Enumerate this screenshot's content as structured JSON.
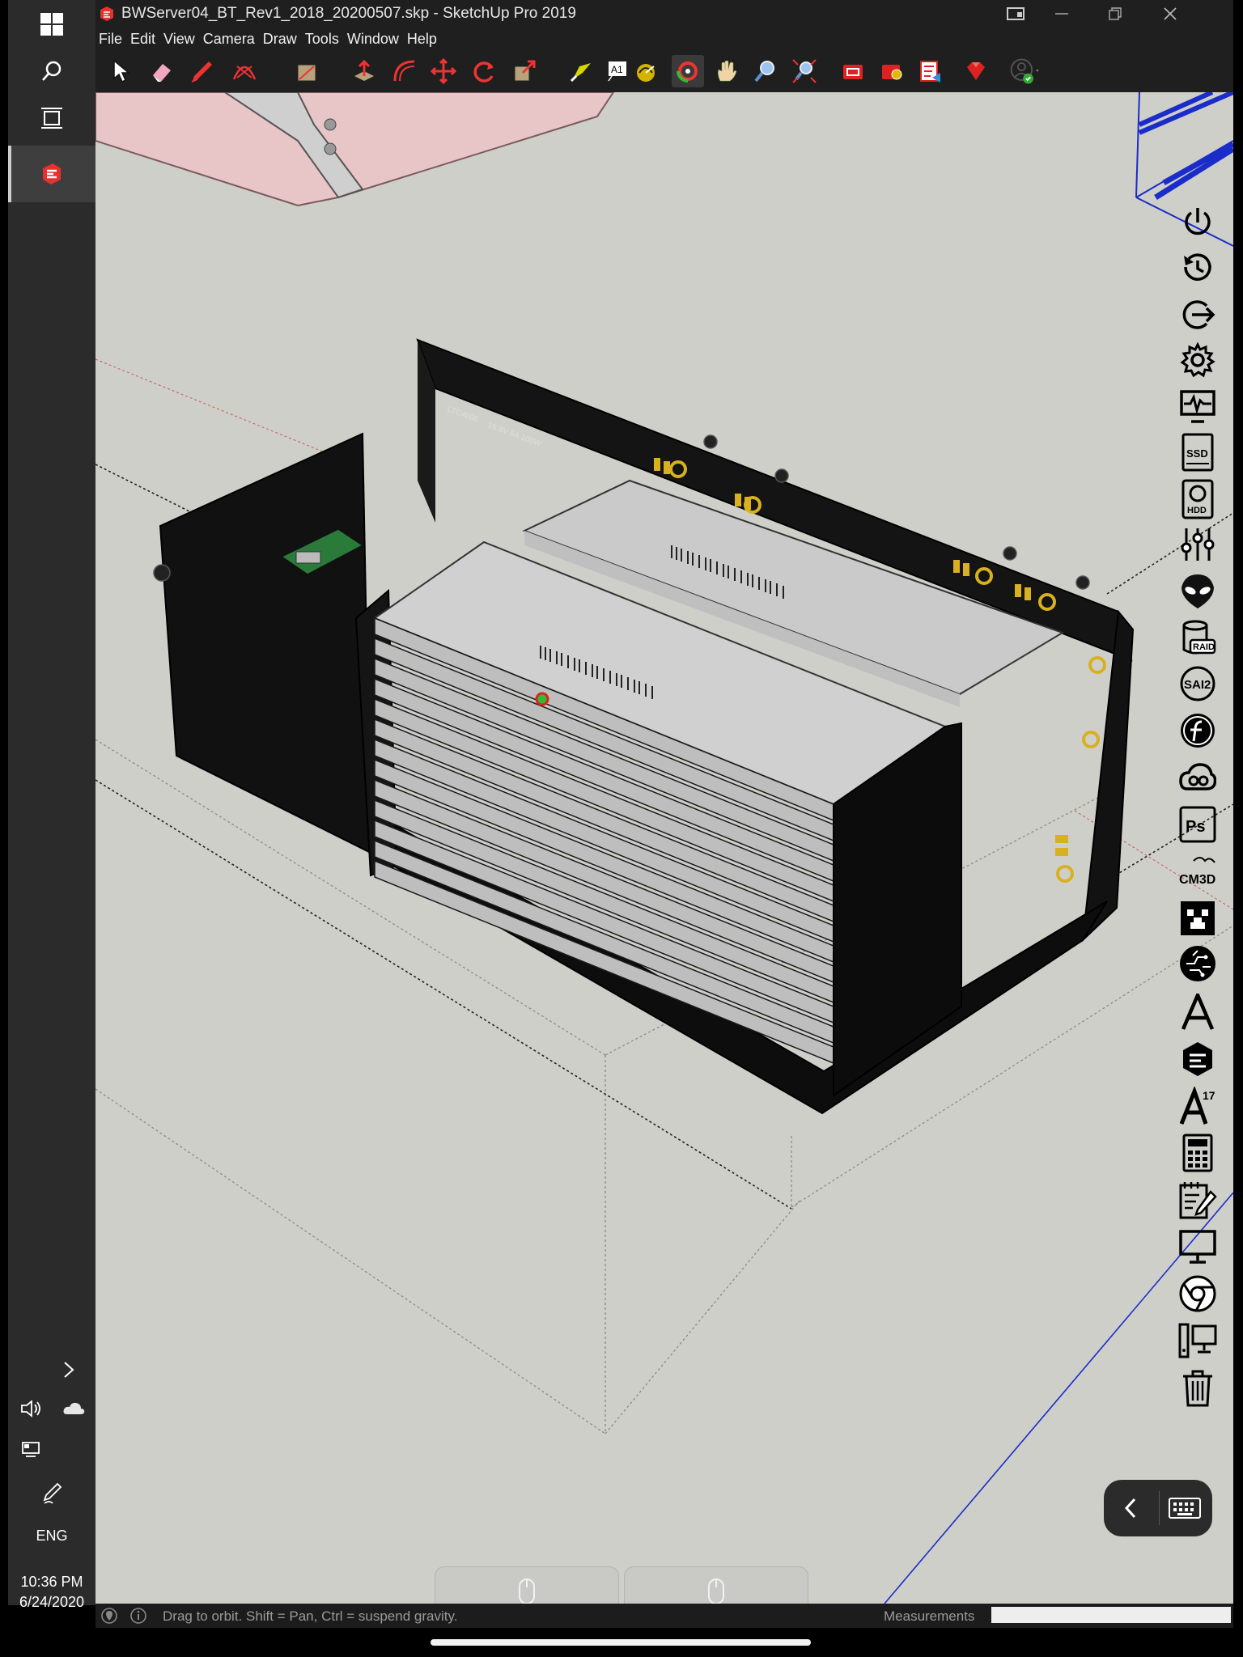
{
  "window": {
    "title": "BWServer04_BT_Rev1_2018_20200507.skp - SketchUp Pro 2019",
    "app_icon": "sketchup-icon",
    "controls": [
      "minimize-icon",
      "restore-icon",
      "close-icon"
    ]
  },
  "menu": [
    "File",
    "Edit",
    "View",
    "Camera",
    "Draw",
    "Tools",
    "Window",
    "Help"
  ],
  "toolbar": {
    "tools": [
      "select-arrow-icon",
      "eraser-icon",
      "line-pencil-icon",
      "arc-icon",
      "rectangle-icon",
      "push-pull-icon",
      "offset-icon",
      "move-icon",
      "rotate-icon",
      "scale-icon",
      "paint-bucket-icon",
      "text-icon",
      "tape-measure-icon",
      "orbit-icon",
      "pan-icon",
      "zoom-icon",
      "zoom-extents-icon",
      "3d-warehouse-icon",
      "extension-warehouse-icon",
      "layout-icon",
      "ruby-icon",
      "account-icon"
    ],
    "selected": "orbit-icon"
  },
  "status": {
    "hint": "Drag to orbit. Shift = Pan, Ctrl = suspend gravity.",
    "measurements_label": "Measurements",
    "measurements_value": ""
  },
  "taskbar": {
    "items": [
      "windows-start-icon",
      "search-icon",
      "task-view-icon",
      "sketchup-taskbar-icon"
    ],
    "tray_expand": "chevron-right-icon",
    "volume": "volume-icon",
    "cloud": "onedrive-cloud-icon",
    "network": "network-icon",
    "pen": "pen-icon",
    "language": "ENG",
    "time": "10:36 PM",
    "date": "6/24/2020"
  },
  "launcher": {
    "labels": {
      "ssd": "SSD",
      "hdd": "HDD",
      "raid": "RAID",
      "sai": "SAI2",
      "cm3d": "CM3D",
      "ps": "Ps",
      "a17": "17"
    },
    "items": [
      "power-icon",
      "history-icon",
      "logout-icon",
      "settings-icon",
      "monitor-pulse-icon",
      "ssd-icon",
      "hdd-icon",
      "mixer-sliders-icon",
      "alien-head-icon",
      "raid-icon",
      "sai2-icon",
      "fusion-icon",
      "creative-cloud-icon",
      "photoshop-icon",
      "cm3d-icon",
      "minecraft-icon",
      "circuit-brain-icon",
      "font-a-icon",
      "sketchup-icon",
      "autocad-17-icon",
      "calculator-icon",
      "notepad-icon",
      "desktop-icon",
      "chrome-icon",
      "remote-desktop-icon",
      "trash-icon"
    ]
  },
  "keyboard_pill": [
    "chevron-left-icon",
    "keyboard-icon"
  ],
  "model": {
    "label_1": "LTC4006",
    "label_2": "16.8V 6A 100W"
  }
}
